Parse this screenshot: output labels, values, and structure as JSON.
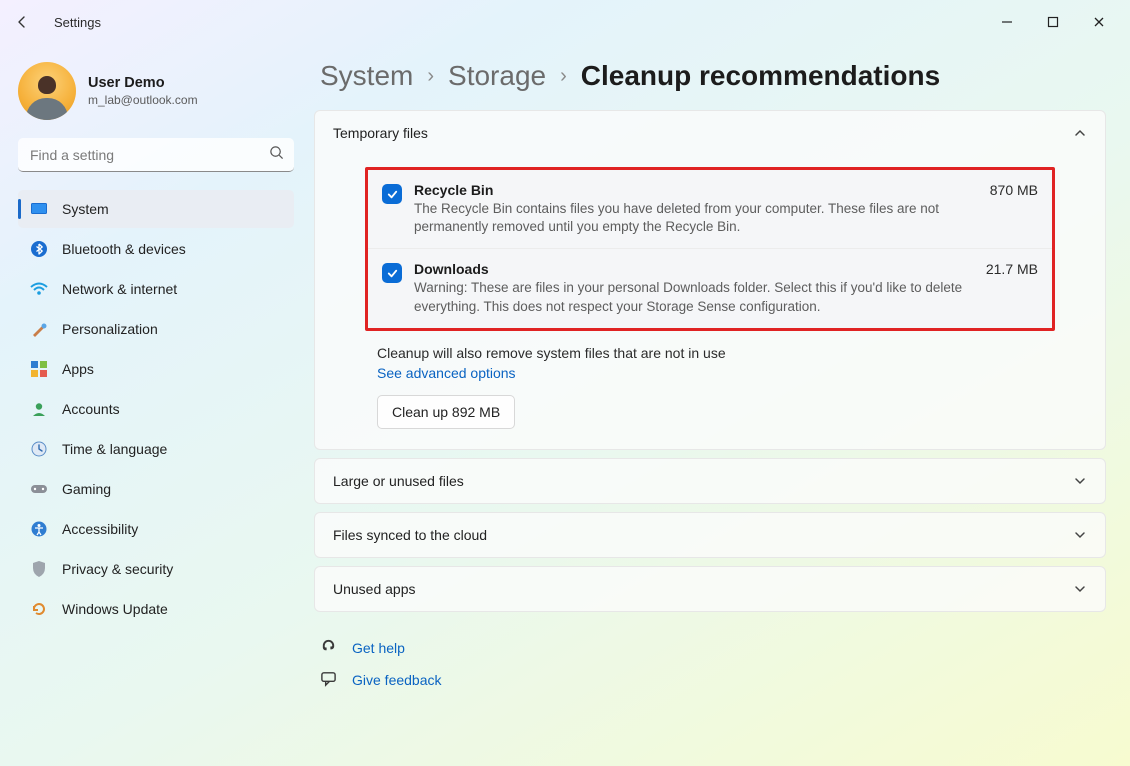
{
  "window": {
    "app_title": "Settings"
  },
  "user": {
    "name": "User Demo",
    "email": "m_lab@outlook.com"
  },
  "search": {
    "placeholder": "Find a setting"
  },
  "sidebar": {
    "items": [
      {
        "label": "System"
      },
      {
        "label": "Bluetooth & devices"
      },
      {
        "label": "Network & internet"
      },
      {
        "label": "Personalization"
      },
      {
        "label": "Apps"
      },
      {
        "label": "Accounts"
      },
      {
        "label": "Time & language"
      },
      {
        "label": "Gaming"
      },
      {
        "label": "Accessibility"
      },
      {
        "label": "Privacy & security"
      },
      {
        "label": "Windows Update"
      }
    ]
  },
  "breadcrumb": {
    "a": "System",
    "b": "Storage",
    "current": "Cleanup recommendations"
  },
  "sections": {
    "temp": {
      "title": "Temporary files",
      "items": [
        {
          "title": "Recycle Bin",
          "size": "870 MB",
          "desc": "The Recycle Bin contains files you have deleted from your computer. These files are not permanently removed until you empty the Recycle Bin."
        },
        {
          "title": "Downloads",
          "size": "21.7 MB",
          "desc": "Warning: These are files in your personal Downloads folder. Select this if you'd like to delete everything. This does not respect your Storage Sense configuration."
        }
      ],
      "note": "Cleanup will also remove system files that are not in use",
      "advanced_link": "See advanced options",
      "cleanup_button": "Clean up 892 MB"
    },
    "large": {
      "title": "Large or unused files"
    },
    "cloud": {
      "title": "Files synced to the cloud"
    },
    "apps": {
      "title": "Unused apps"
    }
  },
  "footer": {
    "help": "Get help",
    "feedback": "Give feedback"
  }
}
